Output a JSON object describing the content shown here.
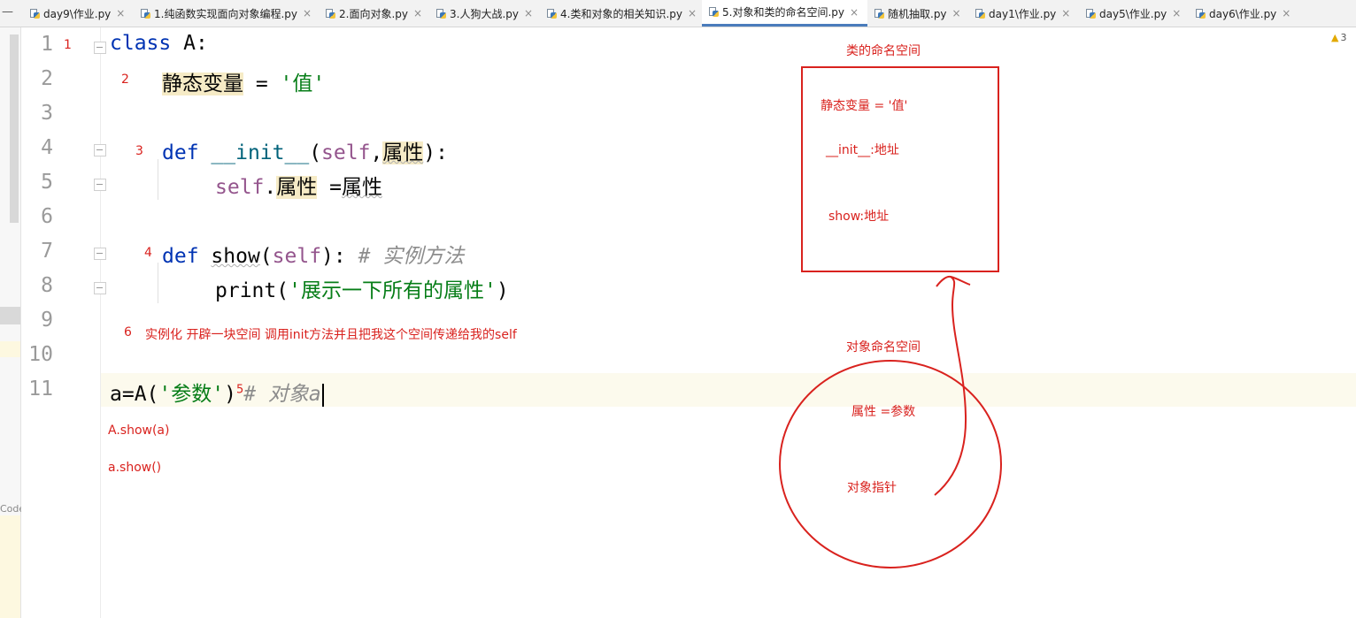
{
  "tabs": [
    {
      "label": "day9\\作业.py",
      "active": false
    },
    {
      "label": "1.纯函数实现面向对象编程.py",
      "active": false
    },
    {
      "label": "2.面向对象.py",
      "active": false
    },
    {
      "label": "3.人狗大战.py",
      "active": false
    },
    {
      "label": "4.类和对象的相关知识.py",
      "active": false
    },
    {
      "label": "5.对象和类的命名空间.py",
      "active": true
    },
    {
      "label": "随机抽取.py",
      "active": false
    },
    {
      "label": "day1\\作业.py",
      "active": false
    },
    {
      "label": "day5\\作业.py",
      "active": false
    },
    {
      "label": "day6\\作业.py",
      "active": false
    }
  ],
  "tab_close_glyph": "×",
  "left_strip_text": "Code",
  "warning_count": "3",
  "line_numbers": [
    "1",
    "2",
    "3",
    "4",
    "5",
    "6",
    "7",
    "8",
    "9",
    "10",
    "11"
  ],
  "code": {
    "l1_kw": "class",
    "l1_rest": " A:",
    "l2_var": "静态变量",
    "l2_eq": " = ",
    "l2_str": "'值'",
    "l4_kw": "def",
    "l4_fn": "__init__",
    "l4_open": "(",
    "l4_self": "self",
    "l4_comma": ",",
    "l4_param": "属性",
    "l4_close": "):",
    "l5_self": "self",
    "l5_dot": ".",
    "l5_attr": "属性",
    "l5_eq": " =",
    "l5_val": "属性",
    "l7_kw": "def",
    "l7_fn": "show",
    "l7_open": "(",
    "l7_self": "self",
    "l7_close": "):",
    "l7_cmt": "# 实例方法",
    "l8_fn": "print",
    "l8_open": "(",
    "l8_str": "'展示一下所有的属性'",
    "l8_close": ")",
    "l11_a": "a=A(",
    "l11_str": "'参数'",
    "l11_close": ")",
    "l11_cmt": "# 对象a"
  },
  "annotations": {
    "n1": "1",
    "n2": "2",
    "n3": "3",
    "n4": "4",
    "n5": "5",
    "n6": "6",
    "instantiate_note": "实例化 开辟一块空间 调用init方法并且把我这个空间传递给我的self",
    "call_class": "A.show(a)",
    "call_obj": "a.show()",
    "class_ns_title": "类的命名空间",
    "class_ns_var": "静态变量 = '值'",
    "class_ns_init": "__init__:地址",
    "class_ns_show": "show:地址",
    "obj_ns_title": "对象命名空间",
    "obj_ns_attr": "属性 =参数",
    "obj_ns_ptr": "对象指针"
  },
  "colors": {
    "annotation": "#d9221e",
    "keyword": "#0033b3",
    "self": "#94558d",
    "function": "#00627a",
    "string": "#067d17",
    "comment": "#8c8c8c",
    "active_tab_underline": "#4a7cbc"
  }
}
